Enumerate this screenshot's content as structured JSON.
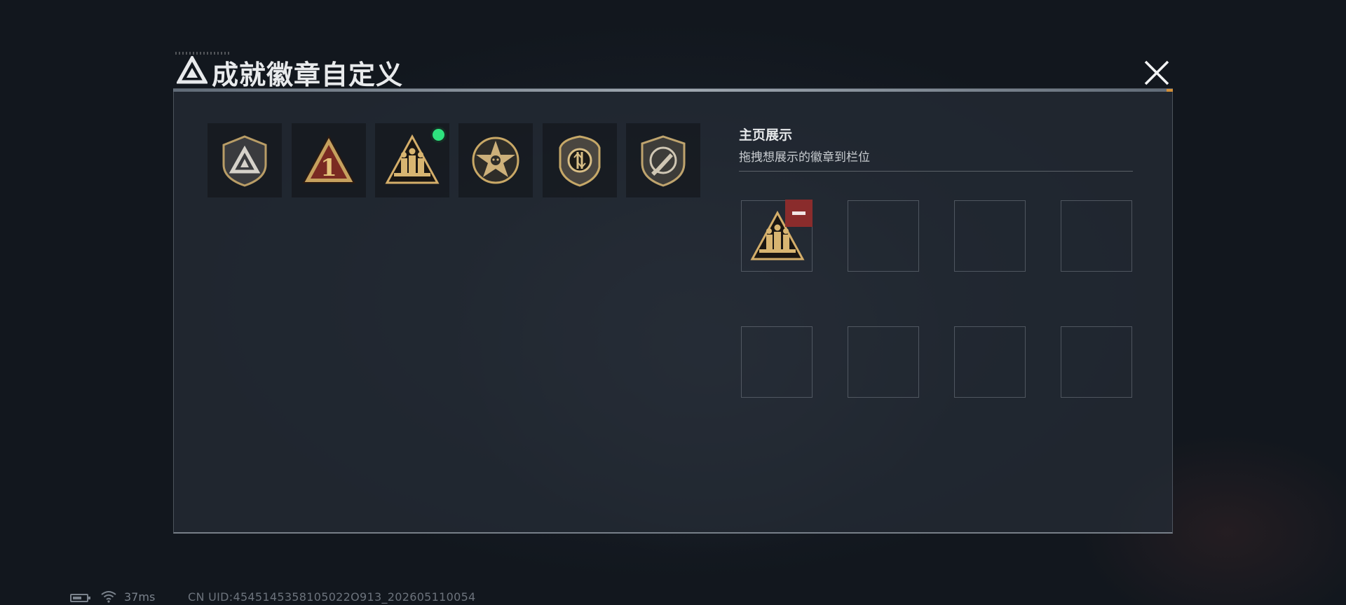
{
  "window": {
    "title": "成就徽章自定义",
    "title_icon": "triangle-logo-icon",
    "close_icon": "close-icon"
  },
  "badges": [
    {
      "icon": "shield-triangle-badge-icon",
      "new": false
    },
    {
      "icon": "triangle-number-one-badge-icon",
      "new": false
    },
    {
      "icon": "triangle-soldiers-badge-icon",
      "new": true
    },
    {
      "icon": "star-skull-badge-icon",
      "new": false
    },
    {
      "icon": "crest-arrows-badge-icon",
      "new": false
    },
    {
      "icon": "shield-knife-badge-icon",
      "new": false
    }
  ],
  "showcase": {
    "title": "主页展示",
    "subtitle": "拖拽想展示的徽章到栏位",
    "slots": [
      {
        "badge": "triangle-soldiers-badge-icon",
        "removable": true
      },
      {
        "badge": null
      },
      {
        "badge": null
      },
      {
        "badge": null
      },
      {
        "badge": null
      },
      {
        "badge": null
      },
      {
        "badge": null
      },
      {
        "badge": null
      }
    ],
    "remove_icon": "minus-icon"
  },
  "status": {
    "battery_icon": "battery-icon",
    "wifi_icon": "wifi-icon",
    "ping": "37ms",
    "uid": "CN UID:4545145358105022O913_202605110054"
  },
  "colors": {
    "gold": "#c9a866",
    "new_indicator": "#2ee37e",
    "remove": "#8a2c2c"
  }
}
